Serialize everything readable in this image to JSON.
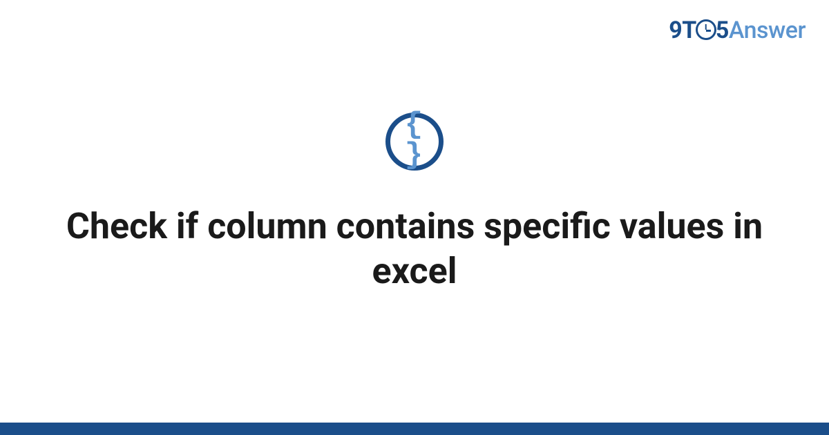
{
  "logo": {
    "part1": "9T",
    "part2": "5",
    "part3": "Answer"
  },
  "category": {
    "icon_glyph": "{ }",
    "icon_name": "code-braces-icon"
  },
  "title": "Check if column contains specific values in excel",
  "colors": {
    "primary": "#1b4e8a",
    "secondary": "#5b94cf"
  }
}
